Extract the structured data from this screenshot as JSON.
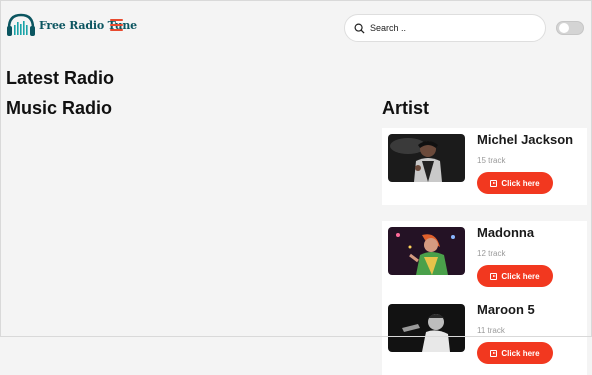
{
  "header": {
    "logo_text": "Free Radio Tune",
    "search_placeholder": "Search .."
  },
  "sections": {
    "latest_title": "Latest Radio",
    "music_title": "Music Radio",
    "artist_title": "Artist"
  },
  "artists": [
    {
      "name": "Michel Jackson",
      "tracks": "15 track",
      "button": "Click here"
    },
    {
      "name": "Madonna",
      "tracks": "12 track",
      "button": "Click here"
    },
    {
      "name": "Maroon 5",
      "tracks": "11 track",
      "button": "Click here"
    }
  ],
  "colors": {
    "accent": "#f2381f",
    "menu_icon": "#e84a2e",
    "logo_text": "#0b5560",
    "page_bg": "#f4f4f4"
  },
  "icons": [
    "headphones-logo-icon",
    "hamburger-menu-icon",
    "search-icon",
    "theme-toggle",
    "play-icon"
  ]
}
